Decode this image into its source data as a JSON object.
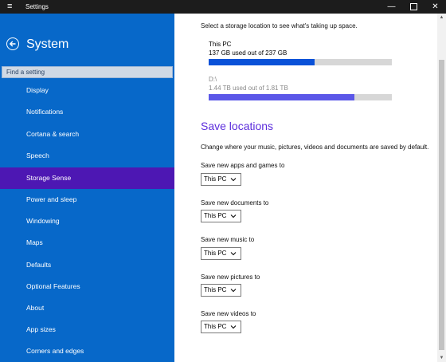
{
  "window": {
    "title": "Settings",
    "menu_icon": "hamburger-icon",
    "minimize_glyph": "—",
    "close_glyph": "✕"
  },
  "sidebar": {
    "title": "System",
    "search_placeholder": "Find a setting",
    "bg_color": "#0768c9",
    "active_color": "#4d17b3",
    "items": [
      {
        "label": "Display"
      },
      {
        "label": "Notifications"
      },
      {
        "label": "Cortana & search"
      },
      {
        "label": "Speech"
      },
      {
        "label": "Storage Sense",
        "active": true
      },
      {
        "label": "Power and sleep"
      },
      {
        "label": "Windowing"
      },
      {
        "label": "Maps"
      },
      {
        "label": "Defaults"
      },
      {
        "label": "Optional Features"
      },
      {
        "label": "About"
      },
      {
        "label": "App sizes"
      },
      {
        "label": "Corners and edges"
      }
    ]
  },
  "storage": {
    "intro": "Select a storage location to see what's taking up space.",
    "drives": [
      {
        "name": "This PC",
        "usage": "137 GB used out of 237 GB",
        "fraction": 0.578,
        "color": "#0a51d8"
      },
      {
        "name": "D:\\",
        "usage": "1.44 TB used out of 1.81 TB",
        "fraction": 0.796,
        "color": "#5b57e8"
      }
    ]
  },
  "save_locations": {
    "title": "Save locations",
    "title_color": "#5c2ddc",
    "description": "Change where your music, pictures, videos and documents are saved by default.",
    "rows": [
      {
        "label": "Save new apps and games to",
        "value": "This PC"
      },
      {
        "label": "Save new documents to",
        "value": "This PC"
      },
      {
        "label": "Save new music to",
        "value": "This PC"
      },
      {
        "label": "Save new pictures to",
        "value": "This PC"
      },
      {
        "label": "Save new videos to",
        "value": "This PC"
      }
    ]
  }
}
